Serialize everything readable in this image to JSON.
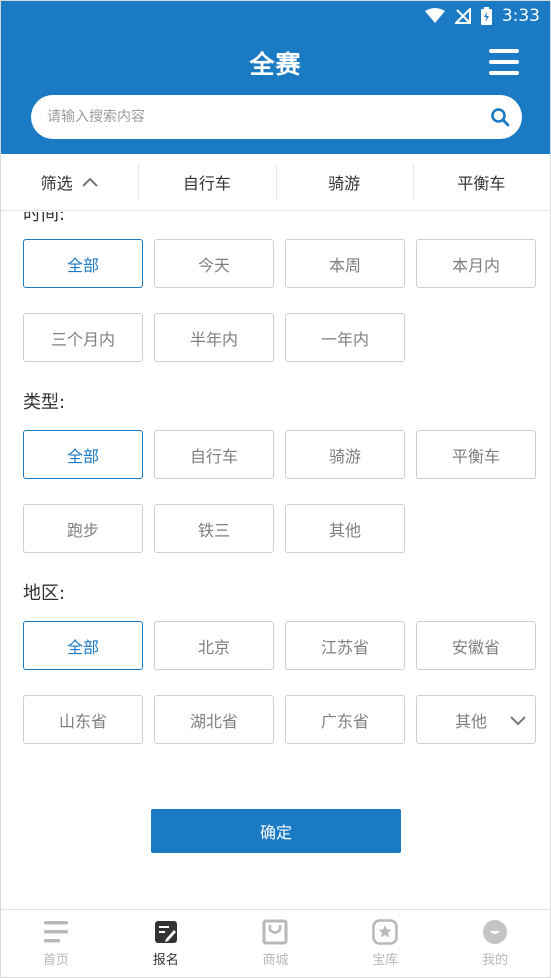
{
  "status_bar": {
    "time": "3:33"
  },
  "header": {
    "title": "全赛",
    "search_placeholder": "请输入搜索内容"
  },
  "filter_bar": {
    "tabs": [
      {
        "label": "筛选"
      },
      {
        "label": "自行车"
      },
      {
        "label": "骑游"
      },
      {
        "label": "平衡车"
      }
    ]
  },
  "filters": {
    "time": {
      "label": "时间:",
      "options": [
        "全部",
        "今天",
        "本周",
        "本月内",
        "三个月内",
        "半年内",
        "一年内"
      ],
      "selected": "全部"
    },
    "type": {
      "label": "类型:",
      "options": [
        "全部",
        "自行车",
        "骑游",
        "平衡车",
        "跑步",
        "铁三",
        "其他"
      ],
      "selected": "全部"
    },
    "region": {
      "label": "地区:",
      "options": [
        "全部",
        "北京",
        "江苏省",
        "安徽省",
        "山东省",
        "湖北省",
        "广东省",
        "其他"
      ],
      "selected": "全部"
    }
  },
  "confirm_label": "确定",
  "tab_bar": {
    "items": [
      {
        "label": "首页",
        "icon": "home-icon"
      },
      {
        "label": "报名",
        "icon": "signup-icon"
      },
      {
        "label": "商城",
        "icon": "shop-icon"
      },
      {
        "label": "宝库",
        "icon": "treasure-icon"
      },
      {
        "label": "我的",
        "icon": "profile-icon"
      }
    ],
    "active": "报名"
  },
  "colors": {
    "primary": "#1a7ac4",
    "inactive_text": "#7f7f7f",
    "border": "#cfcfcf"
  }
}
